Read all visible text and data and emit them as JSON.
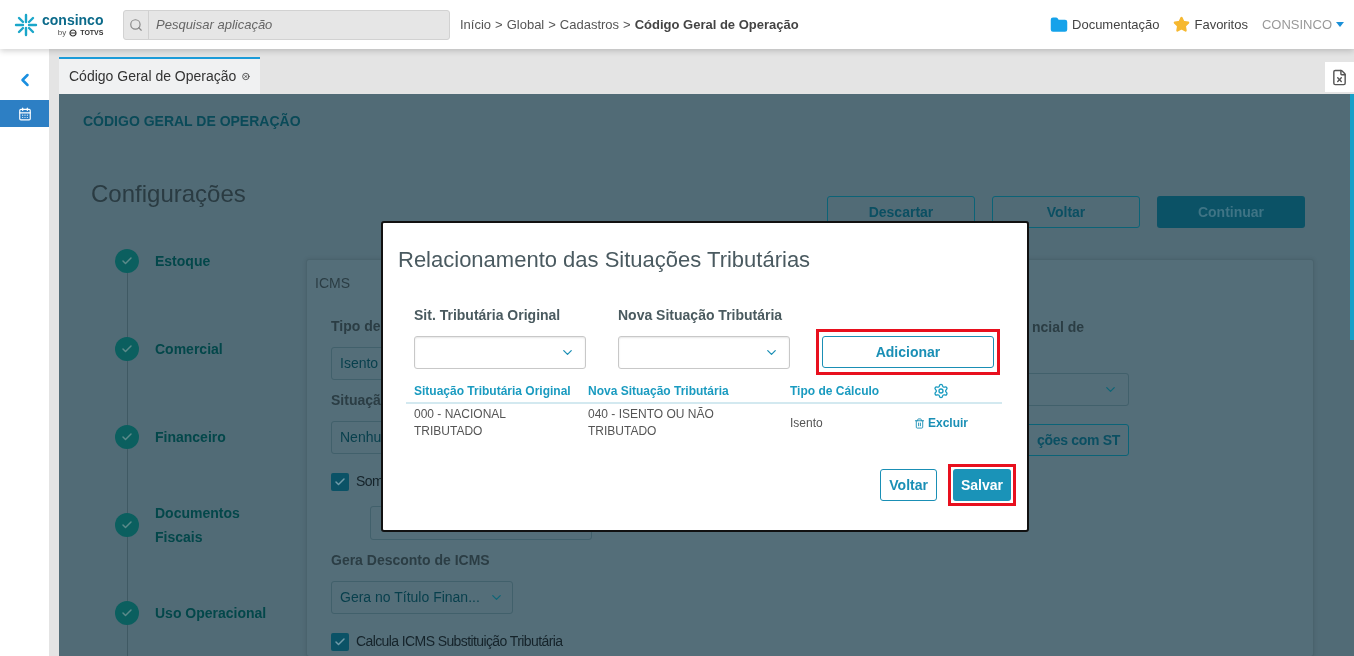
{
  "header": {
    "logo": {
      "name": "consinco",
      "byline": "by",
      "brand": "TOTVS"
    },
    "search": {
      "placeholder": "Pesquisar aplicação"
    },
    "breadcrumb": [
      {
        "label": "Início",
        "separator": ">",
        "current": false
      },
      {
        "label": "Global",
        "separator": ">",
        "current": false
      },
      {
        "label": "Cadastros",
        "separator": ">",
        "current": false
      },
      {
        "label": "Código Geral de Operação",
        "current": true
      }
    ],
    "links": [
      {
        "label": "Documentação",
        "kind": "folder"
      },
      {
        "label": "Favoritos",
        "kind": "star"
      }
    ],
    "user": "CONSINCO"
  },
  "sidebar": {
    "items": [
      {
        "kind": "back",
        "selected": false
      },
      {
        "kind": "calendar",
        "selected": true
      }
    ]
  },
  "tabs": [
    {
      "label": "Código Geral de Operação",
      "selected": true
    }
  ],
  "page": {
    "heading": "CÓDIGO GERAL DE OPERAÇÃO",
    "title": "Configurações",
    "steps": [
      {
        "label": "Estoque",
        "done": true
      },
      {
        "label": "Comercial",
        "done": true
      },
      {
        "label": "Financeiro",
        "done": true
      },
      {
        "label": "Documentos Fiscais",
        "done": true
      },
      {
        "label": "Uso Operacional",
        "done": true
      }
    ],
    "actions": [
      {
        "label": "Descartar",
        "kind": "outline"
      },
      {
        "label": "Voltar",
        "kind": "outline"
      },
      {
        "label": "Continuar",
        "kind": "primary"
      }
    ],
    "card": {
      "title": "ICMS",
      "left": [
        {
          "kind": "label",
          "text": "Tipo de"
        },
        {
          "kind": "select",
          "value": "Isento"
        },
        {
          "kind": "label",
          "text": "Situaçã"
        },
        {
          "kind": "select",
          "value": "Nenhu"
        },
        {
          "kind": "checkbox",
          "label": "Som",
          "checked": true
        },
        {
          "kind": "blank"
        },
        {
          "kind": "label",
          "text": "Gera Desconto de ICMS"
        },
        {
          "kind": "select",
          "value": "Gera no Título Finan...",
          "chevron": true
        },
        {
          "kind": "checkbox",
          "label": "Calcula ICMS Substituição Tributária",
          "checked": true
        }
      ],
      "right": [
        {
          "kind": "label",
          "text": "ncial de"
        },
        {
          "kind": "select",
          "chevron": true
        },
        {
          "kind": "button",
          "text": "ções com ST"
        }
      ]
    }
  },
  "dialog": {
    "title": "Relacionamento das Situações Tributárias",
    "fields": [
      {
        "label": "Sit. Tributária Original"
      },
      {
        "label": "Nova Situação Tributária"
      }
    ],
    "add_button": {
      "label": "Adicionar",
      "highlighted": true
    },
    "table": {
      "columns": [
        "Situação Tributária Original",
        "Nova Situação Tributária",
        "Tipo de Cálculo"
      ],
      "rows": [
        {
          "cells": [
            "000 - NACIONAL TRIBUTADO",
            "040 - ISENTO OU NÃO TRIBUTADO",
            "Isento"
          ],
          "action": "Excluir"
        }
      ]
    },
    "buttons": [
      {
        "label": "Voltar",
        "kind": "outline",
        "highlighted": false
      },
      {
        "label": "Salvar",
        "kind": "primary",
        "highlighted": true
      }
    ]
  }
}
